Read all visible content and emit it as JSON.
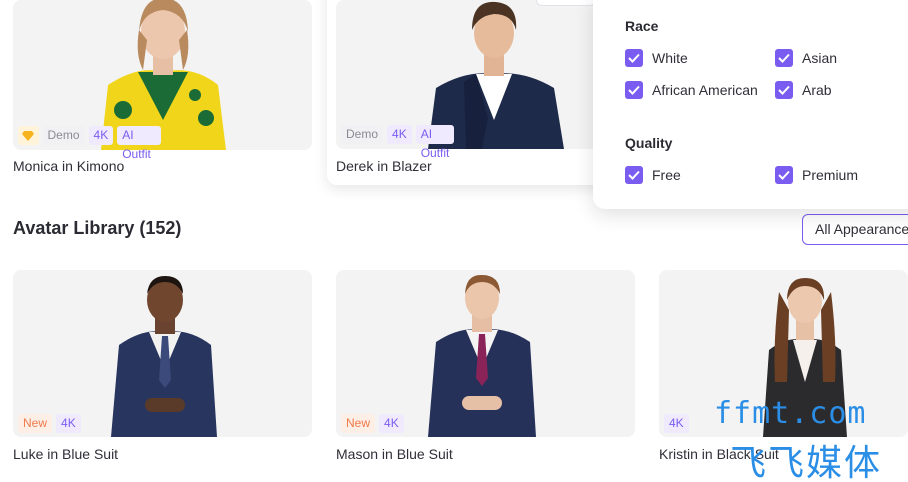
{
  "top_section": {
    "title_fragment": "",
    "cards": [
      {
        "title": "Monica in Kimono",
        "badges": [
          "diamond",
          "Demo",
          "4K",
          "AI Outfit"
        ]
      },
      {
        "title": "Derek in Blazer",
        "badges": [
          "Demo",
          "4K",
          "AI Outfit"
        ]
      }
    ]
  },
  "library": {
    "title": "Avatar Library (152)",
    "appearance_button": "All Appearance",
    "cards": [
      {
        "title": "Luke in Blue Suit",
        "badges": [
          "New",
          "4K"
        ]
      },
      {
        "title": "Mason in Blue Suit",
        "badges": [
          "New",
          "4K"
        ]
      },
      {
        "title": "Kristin in Black Suit",
        "badges": [
          "4K"
        ]
      }
    ]
  },
  "filters": {
    "race": {
      "heading": "Race",
      "options": [
        {
          "label": "White",
          "checked": true
        },
        {
          "label": "Asian",
          "checked": true
        },
        {
          "label": "African American",
          "checked": true
        },
        {
          "label": "Arab",
          "checked": true
        }
      ]
    },
    "quality": {
      "heading": "Quality",
      "options": [
        {
          "label": "Free",
          "checked": true
        },
        {
          "label": "Premium",
          "checked": true
        }
      ]
    }
  },
  "watermark": {
    "line1": "ffmt.com",
    "line2": "飞飞媒体"
  },
  "icons": {
    "premium": "diamond-icon",
    "check": "checkmark-icon"
  },
  "colors": {
    "accent": "#7a5cf0",
    "new_badge": "#ee7a4a",
    "watermark": "#2a8ee6"
  }
}
